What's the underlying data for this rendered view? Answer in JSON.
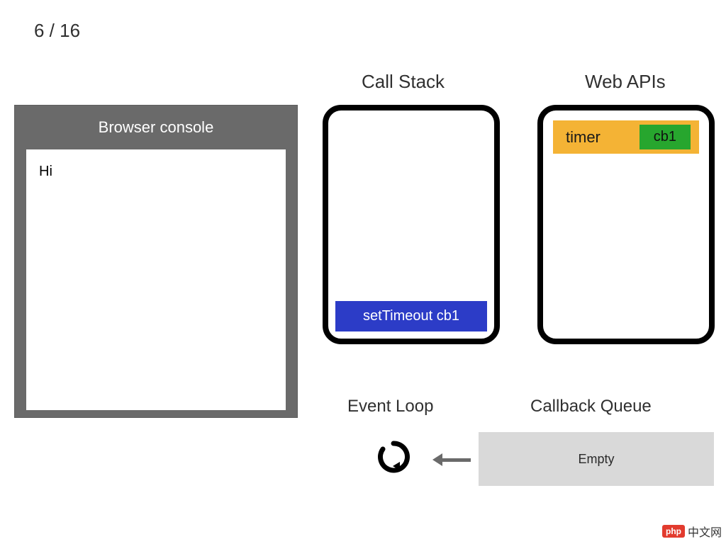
{
  "step": {
    "current": 6,
    "total": 16,
    "display": "6 / 16"
  },
  "console": {
    "title": "Browser console",
    "lines": [
      "Hi"
    ]
  },
  "callStack": {
    "title": "Call Stack",
    "frames": [
      "setTimeout cb1"
    ]
  },
  "webApis": {
    "title": "Web APIs",
    "entries": [
      {
        "label": "timer",
        "callback": "cb1"
      }
    ]
  },
  "eventLoop": {
    "title": "Event Loop"
  },
  "callbackQueue": {
    "title": "Callback Queue",
    "status": "Empty"
  },
  "watermark": {
    "badge": "php",
    "text": "中文网"
  }
}
